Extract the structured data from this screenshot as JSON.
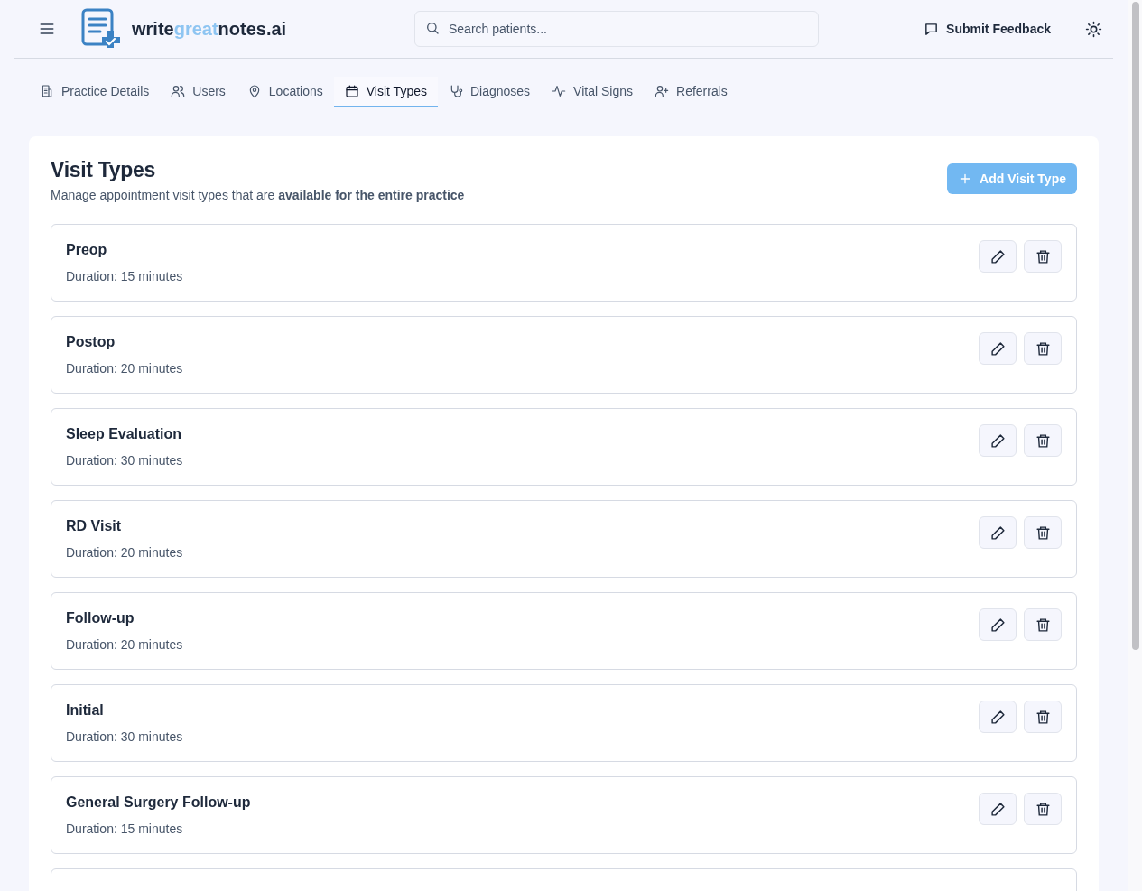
{
  "header": {
    "logo": [
      {
        "text": "write",
        "accent": false
      },
      {
        "text": "great",
        "accent": true
      },
      {
        "text": "notes.ai",
        "accent": false
      }
    ],
    "search": {
      "placeholder": "Search patients..."
    },
    "feedback_button": "Submit Feedback"
  },
  "tabs": [
    {
      "label": "Practice Details",
      "selected": false
    },
    {
      "label": "Users",
      "selected": false
    },
    {
      "label": "Locations",
      "selected": false
    },
    {
      "label": "Visit Types",
      "selected": true
    },
    {
      "label": "Diagnoses",
      "selected": false
    },
    {
      "label": "Vital Signs",
      "selected": false
    },
    {
      "label": "Referrals",
      "selected": false
    }
  ],
  "panel": {
    "title": "Visit Types",
    "subtitle": "Manage appointment visit types that are **available for the entire practice**",
    "add_button": "Add Visit Type",
    "visit_types": [
      {
        "name": "Preop",
        "duration": "Duration: 15 minutes"
      },
      {
        "name": "Postop",
        "duration": "Duration: 20 minutes"
      },
      {
        "name": "Sleep Evaluation",
        "duration": "Duration: 30 minutes"
      },
      {
        "name": "RD Visit",
        "duration": "Duration: 20 minutes"
      },
      {
        "name": "Follow-up",
        "duration": "Duration: 20 minutes"
      },
      {
        "name": "Initial",
        "duration": "Duration: 30 minutes"
      },
      {
        "name": "General Surgery Follow-up",
        "duration": "Duration: 15 minutes"
      }
    ]
  }
}
